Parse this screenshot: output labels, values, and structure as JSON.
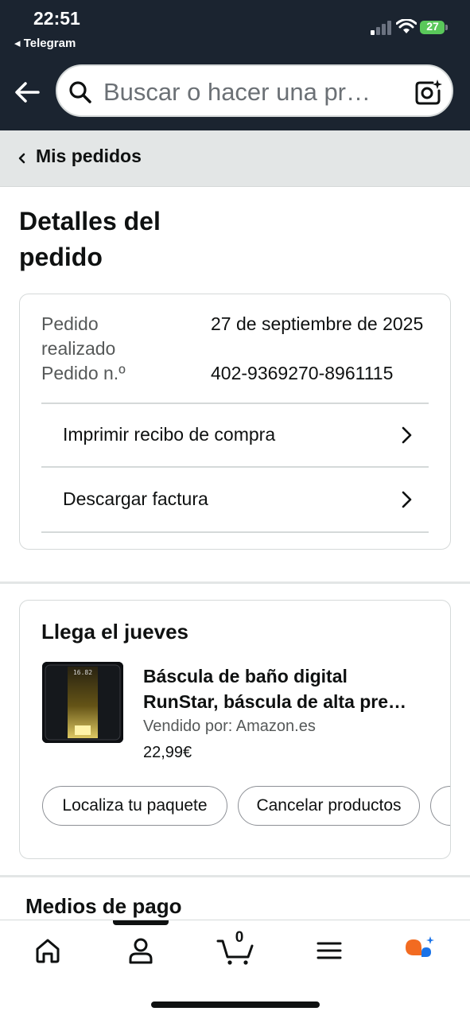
{
  "status_bar": {
    "time": "22:51",
    "back_app": "◂ Telegram",
    "battery": "27"
  },
  "nav": {
    "search_placeholder": "Buscar o hacer una pr…"
  },
  "breadcrumb": {
    "label": "Mis pedidos"
  },
  "page": {
    "title": "Detalles del pedido"
  },
  "order": {
    "placed_label": "Pedido realizado",
    "placed_value": "27 de septiembre de 2025",
    "number_label": "Pedido n.º",
    "number_value": "402-9369270-8961115",
    "links": [
      "Imprimir recibo de compra",
      "Descargar factura"
    ]
  },
  "delivery": {
    "title": "Llega el jueves",
    "product": {
      "title_line1": "Báscula de baño digital",
      "title_line2": "RunStar, báscula de alta pre…",
      "seller": "Vendido por: Amazon.es",
      "price": "22,99€",
      "display_reading": "16.82"
    },
    "buttons": [
      "Localiza tu paquete",
      "Cancelar productos"
    ]
  },
  "payment": {
    "title": "Medios de pago"
  },
  "tab_bar": {
    "items": [
      "home-icon",
      "account-icon",
      "cart-icon",
      "menu-icon",
      "rufus-icon"
    ],
    "cart_count": "0"
  },
  "colors": {
    "header": "#1b2430",
    "breadcrumb_bg": "#e3e6e6",
    "battery": "#5ac85a"
  }
}
